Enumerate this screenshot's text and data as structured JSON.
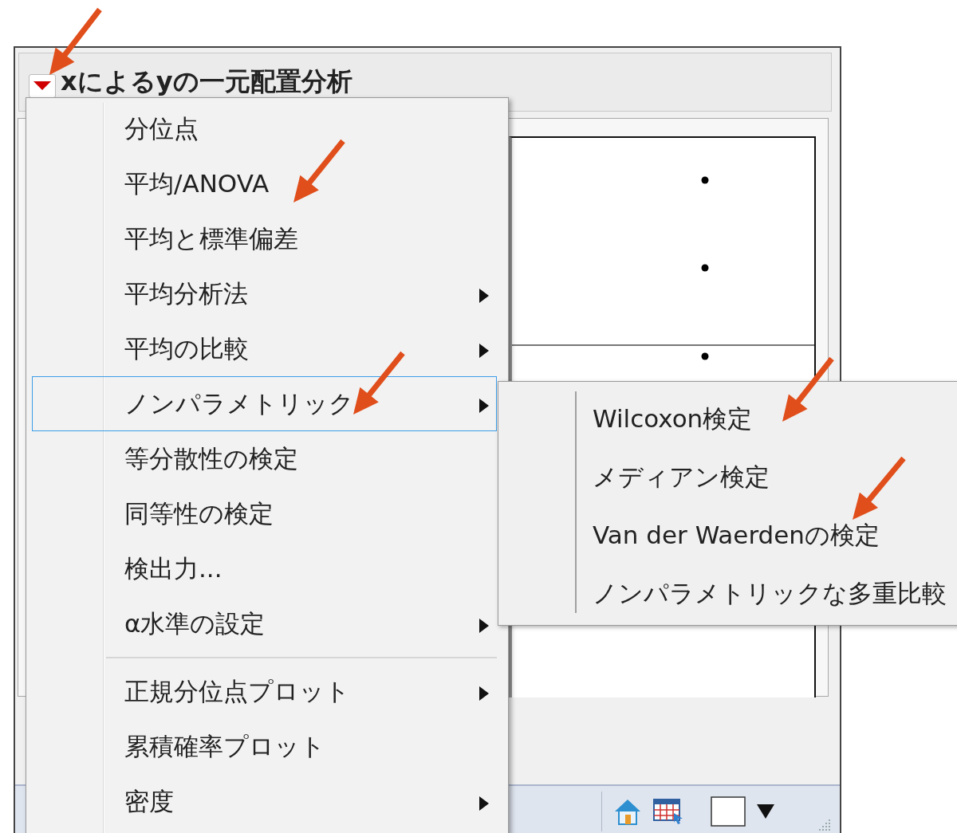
{
  "window": {
    "title": "xによるyの一元配置分析"
  },
  "menu": {
    "items": [
      {
        "kind": "item",
        "label": "分位点",
        "submenu": false,
        "selected": false
      },
      {
        "kind": "item",
        "label": "平均/ANOVA",
        "submenu": false,
        "selected": false
      },
      {
        "kind": "item",
        "label": "平均と標準偏差",
        "submenu": false,
        "selected": false
      },
      {
        "kind": "item",
        "label": "平均分析法",
        "submenu": true,
        "selected": false
      },
      {
        "kind": "item",
        "label": "平均の比較",
        "submenu": true,
        "selected": false
      },
      {
        "kind": "item",
        "label": "ノンパラメトリック",
        "submenu": true,
        "selected": true
      },
      {
        "kind": "item",
        "label": "等分散性の検定",
        "submenu": false,
        "selected": false
      },
      {
        "kind": "item",
        "label": "同等性の検定",
        "submenu": false,
        "selected": false
      },
      {
        "kind": "item",
        "label": "検出力...",
        "submenu": false,
        "selected": false
      },
      {
        "kind": "item",
        "label": "α水準の設定",
        "submenu": true,
        "selected": false
      },
      {
        "kind": "separator"
      },
      {
        "kind": "item",
        "label": "正規分位点プロット",
        "submenu": true,
        "selected": false
      },
      {
        "kind": "item",
        "label": "累積確率プロット",
        "submenu": false,
        "selected": false
      },
      {
        "kind": "item",
        "label": "密度",
        "submenu": true,
        "selected": false
      }
    ]
  },
  "submenu": {
    "items": [
      {
        "label": "Wilcoxon検定"
      },
      {
        "label": "メディアン検定"
      },
      {
        "label": "Van der Waerdenの検定"
      },
      {
        "label": "ノンパラメトリックな多重比較"
      }
    ]
  }
}
